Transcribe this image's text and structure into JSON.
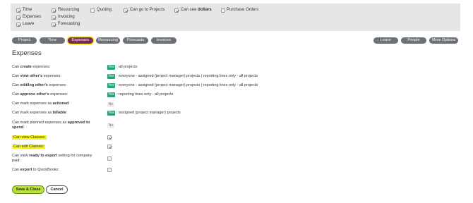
{
  "permissions_panel": {
    "time": "Time",
    "resourcing": "Resourcing",
    "quoting": "Quoting",
    "can_go_to_projects": "Can go to Projects",
    "can_see": "Can see",
    "dollars": "dollars",
    "purchase_orders": "Purchase Orders",
    "expenses": "Expenses",
    "invoicing": "Invoicing",
    "leave": "Leave",
    "forecasting": "Forecasting"
  },
  "tabs": {
    "project": "Project",
    "time": "Time",
    "expenses": "Expenses",
    "resourcing": "Resourcing",
    "forecasts": "Forecasts",
    "invoices": "Invoices",
    "leave": "Leave",
    "people": "People",
    "more_options": "More Options"
  },
  "section": {
    "title": "Expenses"
  },
  "common": {
    "yes": "Yes",
    "no": "No",
    "can": "Can",
    "expenses_suffix": "expenses:"
  },
  "rows": {
    "create": {
      "pre": "Can ",
      "bold": "create",
      "post": " expenses:",
      "value": ": all projects"
    },
    "view_other": {
      "pre": "Can ",
      "bold": "view other's",
      "post": " expenses:",
      "value": ": everyone - assigned (project manager) projects | reporting lines only - all projects"
    },
    "edit_other": {
      "pre": "Can ",
      "bold": "edit/log other's",
      "post": " expenses:",
      "value": ": everyone - assigned (project manager) projects | reporting lines only - all projects"
    },
    "approve_other": {
      "pre": "Can ",
      "bold": "approve other's",
      "post": " expenses:",
      "value": ": reporting lines only - all projects"
    },
    "actioned": {
      "pre": "Can mark expenses as ",
      "bold": "actioned",
      "post": ":"
    },
    "billable": {
      "pre": "Can mark expenses as ",
      "bold": "billable",
      "post": ":",
      "value": ": assigned (project manager) projects"
    },
    "planned": {
      "pre": "Can mark planned expenses as ",
      "bold": "approved to",
      "line2_bold": "spend",
      "line2_post": ":"
    },
    "view_classes": {
      "text": "Can view Classes:"
    },
    "edit_classes": {
      "text": "Can edit Classes:"
    },
    "ready_export": {
      "pre": "Can view ",
      "bold": "ready to export",
      "post": " setting for company",
      "line2": "paid:"
    },
    "export_qb": {
      "pre": "Can ",
      "bold": "export",
      "post": " to QuickBooks:"
    }
  },
  "buttons": {
    "save_close": "Save & Close",
    "cancel": "Cancel"
  },
  "colors": {
    "yes_badge": "#21a67a",
    "active_tab": "#7a2a55",
    "highlight": "#f5f020",
    "save_button": "#b6e23a"
  }
}
